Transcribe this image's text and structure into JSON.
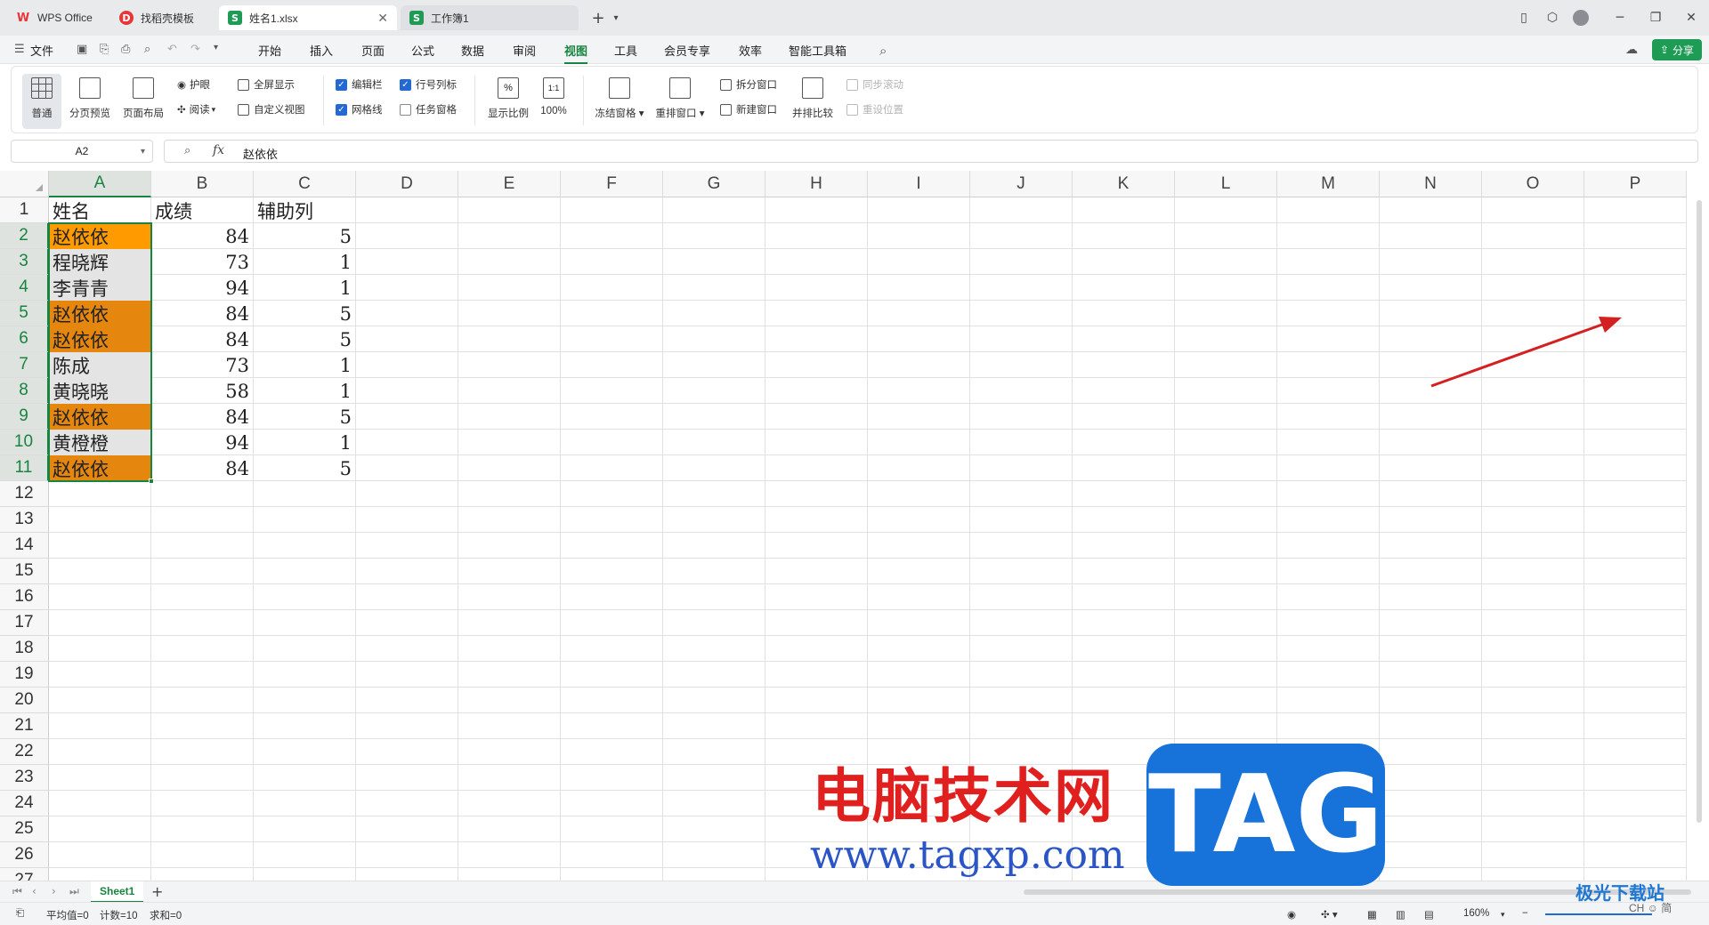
{
  "titlebar": {
    "tabs": [
      {
        "label": "WPS Office",
        "icon": "wps-logo-icon",
        "color": "#e6363a"
      },
      {
        "label": "找稻壳模板",
        "icon": "docer-icon",
        "color": "#e6363a"
      },
      {
        "label": "姓名1.xlsx",
        "icon": "sheet-icon",
        "color": "#1e9b55"
      },
      {
        "label": "工作簿1",
        "icon": "sheet-icon",
        "color": "#1e9b55"
      }
    ],
    "new_tab": "+"
  },
  "menubar": {
    "file": "文件",
    "items": [
      "开始",
      "插入",
      "页面",
      "公式",
      "数据",
      "审阅",
      "视图",
      "工具",
      "会员专享",
      "效率",
      "智能工具箱"
    ],
    "active": "视图",
    "share": "分享"
  },
  "ribbon": {
    "normal": "普通",
    "page_break": "分页预览",
    "page_layout": "页面布局",
    "eye_protect": "护眼",
    "read": "阅读",
    "fullscreen": "全屏显示",
    "custom_view": "自定义视图",
    "formula_bar": "编辑栏",
    "gridlines": "网格线",
    "headings": "行号列标",
    "task_pane": "任务窗格",
    "zoom_ratio": "显示比例",
    "zoom_100": "100%",
    "freeze": "冻结窗格",
    "rearrange": "重排窗口",
    "split": "拆分窗口",
    "new_window": "新建窗口",
    "side_by_side": "并排比较",
    "sync_scroll": "同步滚动",
    "reset_pos": "重设位置",
    "checks": {
      "formula_bar": true,
      "gridlines": true,
      "headings": true,
      "task_pane": false
    }
  },
  "formula": {
    "cell_ref": "A2",
    "fx": "fx",
    "value": "赵依依"
  },
  "sheet": {
    "columns": [
      "A",
      "B",
      "C",
      "D",
      "E",
      "F",
      "G",
      "H",
      "I",
      "J",
      "K",
      "L",
      "M",
      "N",
      "O",
      "P"
    ],
    "rows": [
      "1",
      "2",
      "3",
      "4",
      "5",
      "6",
      "7",
      "8",
      "9",
      "10",
      "11",
      "12",
      "13",
      "14",
      "15",
      "16",
      "17",
      "18",
      "19",
      "20",
      "21",
      "22",
      "23",
      "24",
      "25",
      "26",
      "27"
    ],
    "header": [
      "姓名",
      "成绩",
      "辅助列"
    ],
    "data": [
      {
        "name": "赵依依",
        "score": "84",
        "aux": "5",
        "highlight": true
      },
      {
        "name": "程晓辉",
        "score": "73",
        "aux": "1",
        "highlight": false
      },
      {
        "name": "李青青",
        "score": "94",
        "aux": "1",
        "highlight": false
      },
      {
        "name": "赵依依",
        "score": "84",
        "aux": "5",
        "highlight": true
      },
      {
        "name": "赵依依",
        "score": "84",
        "aux": "5",
        "highlight": true
      },
      {
        "name": "陈成",
        "score": "73",
        "aux": "1",
        "highlight": false
      },
      {
        "name": "黄晓晓",
        "score": "58",
        "aux": "1",
        "highlight": false
      },
      {
        "name": "赵依依",
        "score": "84",
        "aux": "5",
        "highlight": true
      },
      {
        "name": "黄橙橙",
        "score": "94",
        "aux": "1",
        "highlight": false
      },
      {
        "name": "赵依依",
        "score": "84",
        "aux": "5",
        "highlight": true
      }
    ],
    "highlight_color": "#e5860f",
    "active_color": "#ff9b00",
    "selected_fill": "#e4e4e4",
    "tab": "Sheet1"
  },
  "status": {
    "average": "平均值=0",
    "count": "计数=10",
    "sum": "求和=0",
    "zoom": "160%"
  },
  "watermark": {
    "title": "电脑技术网",
    "url": "www.tagxp.com",
    "badge": "TAG",
    "corner": "极光下载站",
    "corner_sub": "CH ☺ 简"
  }
}
